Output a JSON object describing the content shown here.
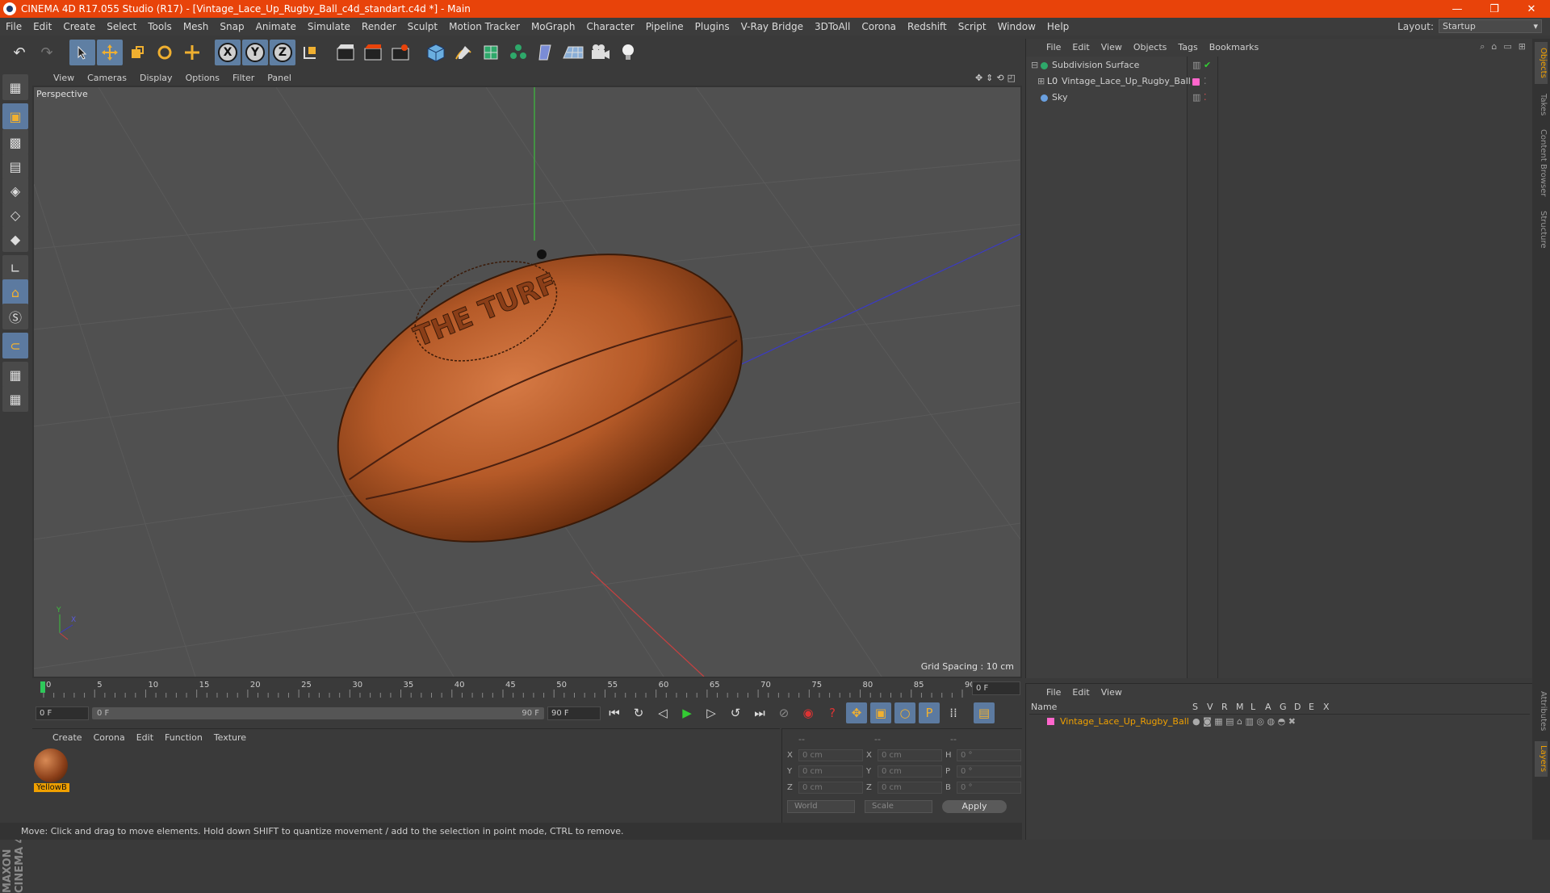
{
  "window": {
    "title": "CINEMA 4D R17.055 Studio (R17) - [Vintage_Lace_Up_Rugby_Ball_c4d_standart.c4d *] - Main",
    "minimize": "—",
    "restore": "❐",
    "close": "✕"
  },
  "menubar": {
    "items": [
      "File",
      "Edit",
      "Create",
      "Select",
      "Tools",
      "Mesh",
      "Snap",
      "Animate",
      "Simulate",
      "Render",
      "Sculpt",
      "Motion Tracker",
      "MoGraph",
      "Character",
      "Pipeline",
      "Plugins",
      "V-Ray Bridge",
      "3DToAll",
      "Corona",
      "Redshift",
      "Script",
      "Window",
      "Help"
    ],
    "layout_label": "Layout:",
    "layout_value": "Startup"
  },
  "toolbar": {
    "undo": "↶",
    "redo": "↷",
    "axis_x": "X",
    "axis_y": "Y",
    "axis_z": "Z"
  },
  "viewport": {
    "menu": [
      "View",
      "Cameras",
      "Display",
      "Options",
      "Filter",
      "Panel"
    ],
    "label": "Perspective",
    "grid_spacing": "Grid Spacing : 10 cm",
    "axis_y_label": "Y",
    "axis_x_label": "X",
    "ball_text": "THE TURF"
  },
  "timeline": {
    "ticks": [
      "0",
      "5",
      "10",
      "15",
      "20",
      "25",
      "30",
      "35",
      "40",
      "45",
      "50",
      "55",
      "60",
      "65",
      "70",
      "75",
      "80",
      "85",
      "90"
    ],
    "current_frame": "0 F"
  },
  "playbar": {
    "start": "0 F",
    "range_start": "0 F",
    "range_end": "90 F",
    "end": "90 F"
  },
  "material_manager": {
    "menu": [
      "Create",
      "Corona",
      "Edit",
      "Function",
      "Texture"
    ],
    "material_name": "YellowB"
  },
  "coordinates": {
    "header": [
      "--",
      "--",
      "--"
    ],
    "rows": [
      {
        "a": "X",
        "av": "0 cm",
        "b": "X",
        "bv": "0 cm",
        "c": "H",
        "cv": "0 °"
      },
      {
        "a": "Y",
        "av": "0 cm",
        "b": "Y",
        "bv": "0 cm",
        "c": "P",
        "cv": "0 °"
      },
      {
        "a": "Z",
        "av": "0 cm",
        "b": "Z",
        "bv": "0 cm",
        "c": "B",
        "cv": "0 °"
      }
    ],
    "mode_world": "World",
    "mode_scale": "Scale",
    "apply": "Apply"
  },
  "status": {
    "text": "Move: Click and drag to move elements. Hold down SHIFT to quantize movement / add to the selection in point mode, CTRL to remove."
  },
  "object_manager": {
    "menu": [
      "File",
      "Edit",
      "View",
      "Objects",
      "Tags",
      "Bookmarks"
    ],
    "objects": [
      {
        "name": "Subdivision Surface",
        "color": "#2ea86a"
      },
      {
        "name": "Vintage_Lace_Up_Rugby_Ball",
        "color": "#e0e0e0"
      },
      {
        "name": "Sky",
        "color": "#6aa0e0"
      }
    ]
  },
  "layer_manager": {
    "menu": [
      "File",
      "Edit",
      "View"
    ],
    "columns": [
      "Name",
      "S",
      "V",
      "R",
      "M",
      "L",
      "A",
      "G",
      "D",
      "E",
      "X"
    ],
    "layer_name": "Vintage_Lace_Up_Rugby_Ball",
    "layer_color": "#ff66cc"
  },
  "side_tabs": [
    "Objects",
    "Takes",
    "Content Browser",
    "Structure"
  ],
  "side_tabs_bottom": [
    "Attributes",
    "Layers"
  ],
  "colors": {
    "title_bar": "#e8430a",
    "active_tool": "#5c7aa0",
    "highlight": "#f0a000"
  }
}
